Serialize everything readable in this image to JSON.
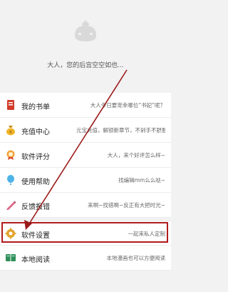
{
  "header": {
    "greeting": "大人，您的后宫空空如也..."
  },
  "menu": [
    {
      "title": "我的书单",
      "desc": "大人今日要宠幸哪位“书妃”呢？",
      "icon": "book-list-icon"
    },
    {
      "title": "充值中心",
      "desc": "元宝充值，解锁新章节，不剁手不舒服新番",
      "icon": "coin-bag-icon"
    },
    {
      "title": "软件评分",
      "desc": "大人，来个好评怎么样~",
      "icon": "rating-medal-icon"
    },
    {
      "title": "使用帮助",
      "desc": "找编辑mm么么哒~",
      "icon": "help-balloon-icon"
    },
    {
      "title": "反馈报错",
      "desc": "来啊~找错啊~反正有大把时光~",
      "icon": "pencil-icon"
    },
    {
      "title": "软件设置",
      "desc": "一起来私人定制",
      "icon": "gear-icon"
    },
    {
      "title": "本地阅读",
      "desc": "本地漫画也可以方便阅读",
      "icon": "local-book-icon"
    }
  ],
  "colors": {
    "highlight": "#b01b1b",
    "arrow": "#9b1a1a"
  }
}
